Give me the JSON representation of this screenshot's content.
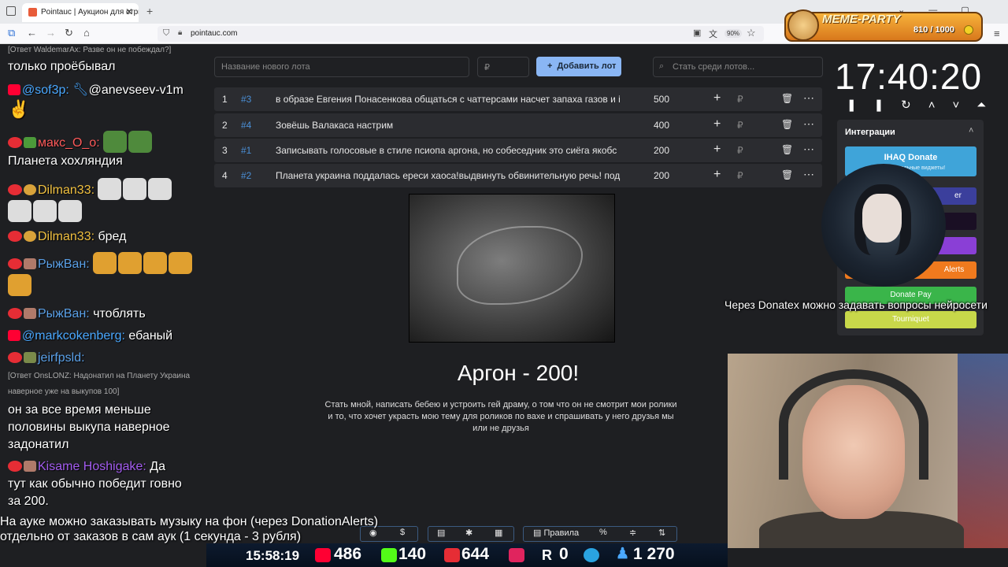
{
  "browser": {
    "tab_title": "Pointauc | Аукцион для стриме",
    "url": "pointauc.com",
    "zoom": "90%"
  },
  "meme_party": {
    "title": "MEME-PARTY",
    "count": "810 / 1000"
  },
  "chat": {
    "reply_top": "[Ответ WaldemarAx: Разве он не побеждал?]",
    "l1": "только проёбывал",
    "l2_user": "@sof3p:",
    "l2_text": "@anevseev-v1m",
    "l3_user": "макс_O_o:",
    "l4_text": "Планета хохляндия",
    "l5_user": "Dilman33:",
    "l6_user": "Dilman33:",
    "l6_text": "бред",
    "l7_user": "РыжВан:",
    "l8_user": "РыжВан:",
    "l8_text": "чтоблять",
    "l9_user": "@markcokenberg:",
    "l9_text": "ебаный",
    "l10_user": "jeirfpsld:",
    "reply_mid_1": "[Ответ OnsLONZ: Надонатил на Планету Украина",
    "reply_mid_2": "наверное уже на выкупов 100]",
    "l11": "он за все время меньше",
    "l12": "половины выкупа наверное",
    "l13": "задонатил",
    "l14_user": "Kisame Hoshigake:",
    "l14_text": "Да",
    "l15": "тут как обычно победит говно",
    "l16": "за 200."
  },
  "auction": {
    "new_lot_placeholder": "Название нового лота",
    "amount_placeholder": "₽",
    "add_button": "Добавить лот",
    "search_placeholder": "Стать среди лотов...",
    "currency": "₽",
    "lots": [
      {
        "num": "1",
        "id": "#3",
        "name": "в образе Евгения Понасенкова общаться с чаттерсами насчет запаха газов и i",
        "amount": "500"
      },
      {
        "num": "2",
        "id": "#4",
        "name": "Зовёшь Валакаса настрим",
        "amount": "400"
      },
      {
        "num": "3",
        "id": "#1",
        "name": "Записывать голосовые в стиле псиопа аргона, но собеседник это сиёга якобс",
        "amount": "200"
      },
      {
        "num": "4",
        "id": "#2",
        "name": "Планета украина поддалась ереси хаоса!выдвинуть обвинительную речь! под",
        "amount": "200"
      }
    ],
    "winner_title": "Аргон - 200!",
    "winner_desc": "Стать мной, написать бебею и устроить гей драму, о том что он не смотрит мои ролики и то, что хочет украсть мою тему для роликов по вахе и спрашивать у него друзья мы или не друзья"
  },
  "timer": {
    "time": "17:40:20"
  },
  "integrations": {
    "title": "Интеграции",
    "ihaq_name": "IHAQ Donate",
    "ihaq_sub": "Ко... Уникальные виджеты!",
    "btn_er": "er",
    "btn_alerts": "Alerts",
    "btn_donatepay": "Donate Pay",
    "btn_tourniquet": "Tourniquet"
  },
  "overlay_note": "Через Donatex можно задавать вопросы нейросети",
  "bottom_notice": {
    "line1": "На ауке можно заказывать музыку на фон (через DonationAlerts)",
    "line2": "отдельно от заказов в сам аук (1 секунда - 3 рубля)"
  },
  "toolbar": {
    "rules": "Правила"
  },
  "stream_stats": {
    "time": "15:58:19",
    "youtube": "486",
    "kick": "140",
    "vk": "644",
    "rutube": "0",
    "telegram": "",
    "viewers": "1 270"
  },
  "colors": {
    "accent": "#8ab6f4",
    "lot_bg": "#2b2c30",
    "live_red": "#e62d35",
    "kick_green": "#53fc18"
  }
}
